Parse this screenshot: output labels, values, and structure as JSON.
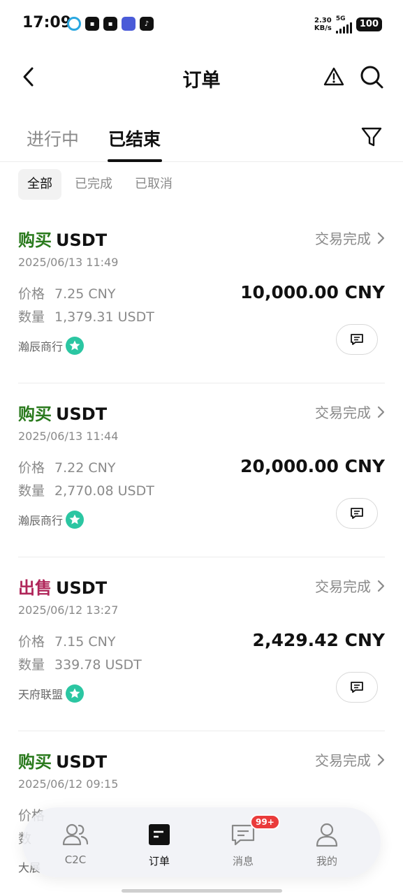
{
  "status_bar": {
    "time": "17:09",
    "net_speed_value": "2.30",
    "net_speed_unit": "KB/s",
    "network": "5G",
    "battery": "100"
  },
  "header": {
    "title": "订单",
    "back_icon": "chevron-left-icon",
    "warning_icon": "warning-icon",
    "search_icon": "search-icon"
  },
  "tabs": [
    {
      "label": "进行中",
      "active": false
    },
    {
      "label": "已结束",
      "active": true
    }
  ],
  "filters": [
    "全部",
    "已完成",
    "已取消"
  ],
  "orders": [
    {
      "type": "购买",
      "asset": "USDT",
      "status": "交易完成",
      "date": "2025/06/13 11:49",
      "price_label": "价格",
      "price": "7.25 CNY",
      "qty_label": "数量",
      "qty": "1,379.31 USDT",
      "total": "10,000.00 CNY",
      "merchant": "瀚辰商行"
    },
    {
      "type": "购买",
      "asset": "USDT",
      "status": "交易完成",
      "date": "2025/06/13 11:44",
      "price_label": "价格",
      "price": "7.22 CNY",
      "qty_label": "数量",
      "qty": "2,770.08 USDT",
      "total": "20,000.00 CNY",
      "merchant": "瀚辰商行"
    },
    {
      "type": "出售",
      "asset": "USDT",
      "status": "交易完成",
      "date": "2025/06/12 13:27",
      "price_label": "价格",
      "price": "7.15 CNY",
      "qty_label": "数量",
      "qty": "339.78 USDT",
      "total": "2,429.42 CNY",
      "merchant": "天府联盟"
    },
    {
      "type": "购买",
      "asset": "USDT",
      "status": "交易完成",
      "date": "2025/06/12 09:15",
      "price_label": "价格",
      "price": "",
      "qty_label": "数",
      "qty": "",
      "total": "",
      "merchant": "大展"
    }
  ],
  "bottom_nav": [
    {
      "label": "C2C",
      "icon": "users-icon"
    },
    {
      "label": "订单",
      "icon": "orders-icon",
      "active": true
    },
    {
      "label": "消息",
      "icon": "message-icon",
      "badge": "99+"
    },
    {
      "label": "我的",
      "icon": "profile-icon"
    }
  ],
  "colors": {
    "buy": "#2a7a1d",
    "sell": "#b0265a",
    "muted": "#8a8a8a",
    "badge": "#ea3b3b"
  }
}
